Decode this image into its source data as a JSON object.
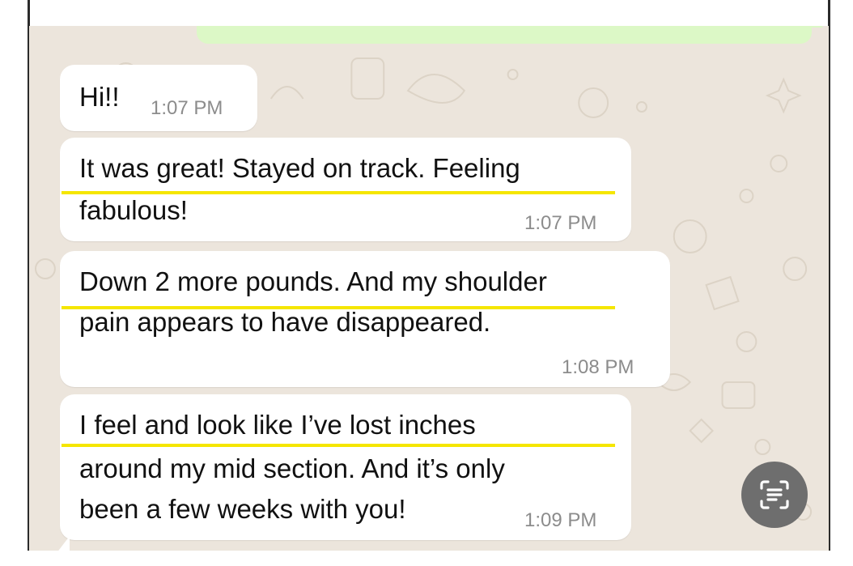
{
  "messages": [
    {
      "lines": [
        "Hi!!"
      ],
      "time": "1:07 PM",
      "highlighted": false
    },
    {
      "lines": [
        "It was great! Stayed on track. Feeling",
        "fabulous!"
      ],
      "time": "1:07 PM",
      "highlighted": true
    },
    {
      "lines": [
        "Down 2 more pounds. And my shoulder",
        "pain appears to have disappeared."
      ],
      "time": "1:08 PM",
      "highlighted": true
    },
    {
      "lines": [
        "I feel and look like I’ve lost inches",
        "around my mid section. And it’s only",
        "been a few weeks with you!"
      ],
      "time": "1:09 PM",
      "highlighted": true
    }
  ],
  "scan_button": {
    "icon": "text-scan-icon"
  },
  "colors": {
    "chat_background": "#ece5dc",
    "incoming_bubble": "#ffffff",
    "outgoing_bubble": "#dcf8c6",
    "highlight": "#f5e600",
    "timestamp": "#8c8c8c"
  }
}
